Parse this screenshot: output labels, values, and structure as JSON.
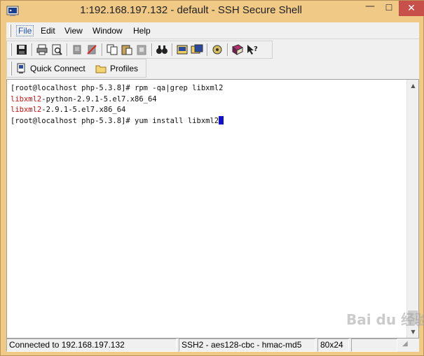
{
  "window": {
    "title": "1:192.168.197.132 - default - SSH Secure Shell",
    "controls": {
      "minimize": "—",
      "maximize": "☐",
      "close": "✕"
    },
    "accent_color": "#f0c987"
  },
  "menu": {
    "items": [
      "File",
      "Edit",
      "View",
      "Window",
      "Help"
    ]
  },
  "toolbar": {
    "icons": [
      "save-icon",
      "print-icon",
      "print-preview-icon",
      "disconnect-icon",
      "disconnect-all-icon",
      "copy-icon",
      "paste-icon",
      "paste-to-other-icon",
      "find-icon",
      "settings-icon",
      "new-terminal-icon",
      "file-transfer-icon",
      "help-book-icon",
      "whats-this-help-icon"
    ]
  },
  "quickbar": {
    "quick_connect": "Quick Connect",
    "profiles": "Profiles"
  },
  "terminal": {
    "lines": [
      [
        {
          "t": "[root@localhost php-5.3.8]# rpm -qa|grep libxml2",
          "c": "normal"
        }
      ],
      [
        {
          "t": "libxml2",
          "c": "red"
        },
        {
          "t": "-python-2.9.1-5.el7.x86_64",
          "c": "normal"
        }
      ],
      [
        {
          "t": "libxml2",
          "c": "red"
        },
        {
          "t": "-2.9.1-5.el7.x86_64",
          "c": "normal"
        }
      ],
      [
        {
          "t": "[root@localhost php-5.3.8]# yum install libxml2",
          "c": "normal"
        }
      ]
    ]
  },
  "status": {
    "connection": "Connected to 192.168.197.132",
    "cipher": "SSH2 - aes128-cbc - hmac-md5",
    "size": "80x24"
  },
  "watermark": "Bai du 经验"
}
